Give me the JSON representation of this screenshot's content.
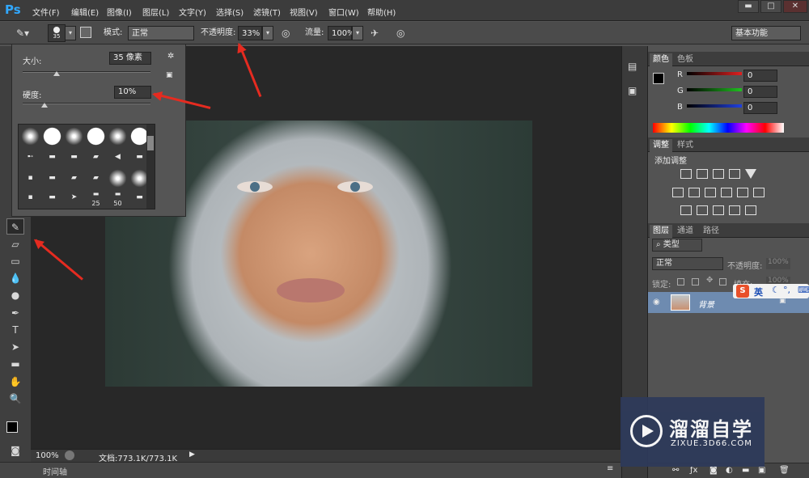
{
  "app": {
    "logo": "Ps"
  },
  "menu": [
    "文件(F)",
    "编辑(E)",
    "图像(I)",
    "图层(L)",
    "文字(Y)",
    "选择(S)",
    "滤镜(T)",
    "视图(V)",
    "窗口(W)",
    "帮助(H)"
  ],
  "window_controls": {
    "minimize": "▬",
    "maximize": "□",
    "close": "✕"
  },
  "options": {
    "brush_size_preview": "35",
    "mode_label": "模式:",
    "mode_value": "正常",
    "opacity_label": "不透明度:",
    "opacity_value": "33%",
    "flow_label": "流量:",
    "flow_value": "100%",
    "workspace": "基本功能"
  },
  "brush_popup": {
    "size_label": "大小:",
    "size_value": "35 像素",
    "hardness_label": "硬度:",
    "hardness_value": "10%",
    "size_level": 0.12,
    "hardness_level": 0.1,
    "preset_numbers": [
      "25",
      "50"
    ]
  },
  "status": {
    "zoom": "100%",
    "doc": "文档:773.1K/773.1K"
  },
  "timeline": {
    "label": "时间轴"
  },
  "color_panel": {
    "tabs": [
      "颜色",
      "色板"
    ],
    "channels": [
      {
        "label": "R",
        "value": "0",
        "color": "#e02020"
      },
      {
        "label": "G",
        "value": "0",
        "color": "#20c020"
      },
      {
        "label": "B",
        "value": "0",
        "color": "#2040e0"
      }
    ]
  },
  "adjust_panel": {
    "tabs": [
      "调整",
      "样式"
    ],
    "title": "添加调整"
  },
  "layers_panel": {
    "tabs": [
      "图层",
      "通道",
      "路径"
    ],
    "filter_kind": "类型",
    "blend_mode": "正常",
    "opacity_label": "不透明度:",
    "opacity_value": "100%",
    "lock_label": "锁定:",
    "fill_label": "填充:",
    "fill_value": "100%",
    "layer_name": "背景"
  },
  "ime": {
    "label": "英"
  },
  "watermark": {
    "title": "溜溜自学",
    "url": "ZIXUE.3D66.COM"
  },
  "colors": {
    "accent": "#31a8ff",
    "arrow": "#e52b20"
  }
}
